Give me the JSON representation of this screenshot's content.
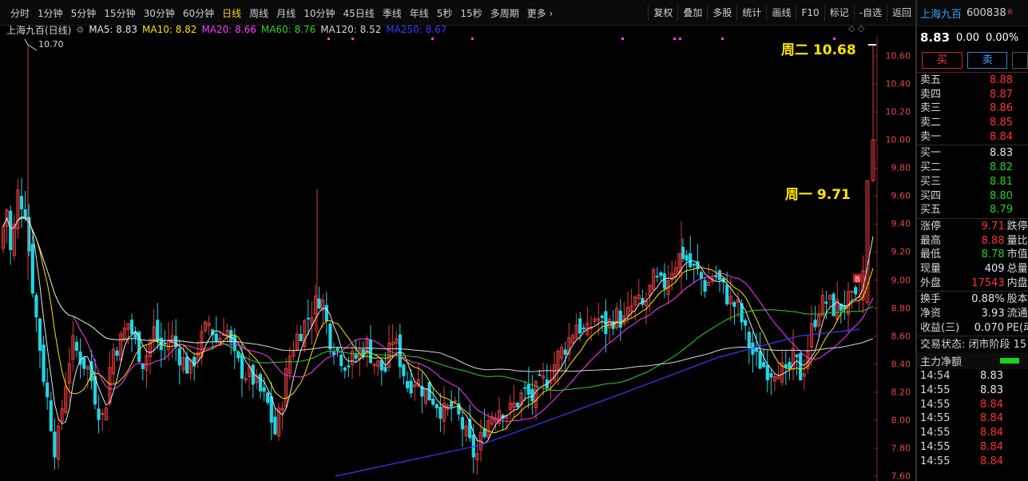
{
  "toolbar": {
    "tabs": [
      "分时",
      "1分钟",
      "5分钟",
      "15分钟",
      "30分钟",
      "60分钟",
      "日线",
      "周线",
      "月线",
      "10分钟",
      "45日线",
      "季线",
      "年线",
      "5秒",
      "15秒",
      "多周期",
      "更多 ›"
    ],
    "active_tab": "日线",
    "tools": [
      "复权",
      "叠加",
      "多股",
      "统计",
      "画线",
      "F10",
      "标记",
      "-自选",
      "返回"
    ]
  },
  "legend": {
    "stock": "上海九百(日线)",
    "ma": [
      {
        "label": "MA5: 8.83",
        "color": "#e6e6e6"
      },
      {
        "label": "MA10: 8.82",
        "color": "#ffe400"
      },
      {
        "label": "MA20: 8.66",
        "color": "#ff3cff"
      },
      {
        "label": "MA60: 8.76",
        "color": "#2fd42f"
      },
      {
        "label": "MA120: 8.52",
        "color": "#d8d8d8"
      },
      {
        "label": "MA250: 8.67",
        "color": "#3b3bff"
      }
    ],
    "corner": "◇ ◇"
  },
  "annotations": {
    "tue": "周二 10.68",
    "mon": "周一 9.71",
    "peak": "10.70",
    "buy_marker": "B"
  },
  "chart_data": {
    "type": "candlestick",
    "y_axis_ticks": [
      "10.60",
      "10.40",
      "10.20",
      "10.00",
      "9.80",
      "9.60",
      "9.40",
      "9.20",
      "9.00",
      "8.80",
      "8.60",
      "8.40",
      "8.20",
      "8.00",
      "7.80",
      "7.60"
    ],
    "ylim": [
      7.6,
      10.68
    ],
    "up_color": "#e33b3b",
    "down_color": "#1fd6e6"
  },
  "panel": {
    "name": "上海九百",
    "code": "600838",
    "code_badge": "R",
    "price": "8.83",
    "change": "0.00",
    "change_pct": "0.00%",
    "buy_label": "买",
    "sell_label": "卖",
    "asks": [
      {
        "label": "卖五",
        "price": "8.88"
      },
      {
        "label": "卖四",
        "price": "8.87"
      },
      {
        "label": "卖三",
        "price": "8.86"
      },
      {
        "label": "卖二",
        "price": "8.85"
      },
      {
        "label": "卖一",
        "price": "8.84"
      }
    ],
    "bids": [
      {
        "label": "买一",
        "price": "8.83"
      },
      {
        "label": "买二",
        "price": "8.82"
      },
      {
        "label": "买三",
        "price": "8.81"
      },
      {
        "label": "买四",
        "price": "8.80"
      },
      {
        "label": "买五",
        "price": "8.79"
      }
    ],
    "stats": [
      {
        "label": "涨停",
        "value": "9.71",
        "label2": "跌停"
      },
      {
        "label": "最高",
        "value": "8.88",
        "label2": "量比"
      },
      {
        "label": "最低",
        "value": "8.78",
        "label2": "市值"
      },
      {
        "label": "现量",
        "value": "409",
        "label2": "总量"
      },
      {
        "label": "外盘",
        "value": "17543",
        "label2": "内盘"
      }
    ],
    "stats2": [
      {
        "label": "换手",
        "value": "0.88%",
        "label2": "股本"
      },
      {
        "label": "净资",
        "value": "3.93",
        "label2": "流通"
      },
      {
        "label": "收益(三)",
        "value": "0.070",
        "label2": "PE(动)"
      }
    ],
    "status": "交易状态: 闭市阶段 15",
    "net_label": "主力净额",
    "ticks": [
      {
        "time": "14:54",
        "price": "8.83"
      },
      {
        "time": "14:55",
        "price": "8.83"
      },
      {
        "time": "14:55",
        "price": "8.84"
      },
      {
        "time": "14:55",
        "price": "8.84"
      },
      {
        "time": "14:55",
        "price": "8.84"
      },
      {
        "time": "14:55",
        "price": "8.84"
      },
      {
        "time": "14:55",
        "price": "8.84"
      }
    ]
  }
}
